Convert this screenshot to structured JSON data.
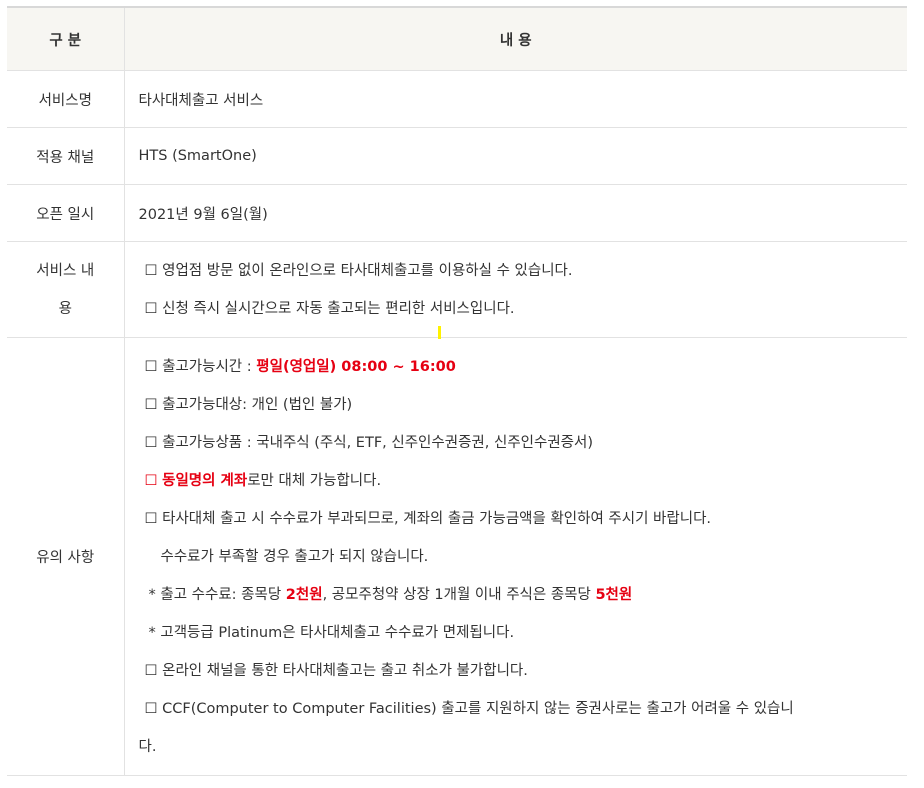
{
  "header": {
    "col1": "구 분",
    "col2": "내 용"
  },
  "rows": {
    "service_name": {
      "label": "서비스명",
      "value": "타사대체출고 서비스"
    },
    "channel": {
      "label": "적용 채널",
      "value": "HTS (SmartOne)"
    },
    "open_date": {
      "label": "오픈 일시",
      "value": "2021년 9월 6일(월)"
    },
    "service_content": {
      "label_line1": "서비스 내",
      "label_line2": "용",
      "lines": [
        "☐ 영업점 방문 없이 온라인으로 타사대체출고를 이용하실 수 있습니다.",
        "☐ 신청 즉시 실시간으로 자동 출고되는 편리한 서비스입니다."
      ]
    },
    "notes": {
      "label": "유의 사항",
      "time_prefix": "☐ 출고가능시간 : ",
      "time_value": "평일(영업일) 08:00 ~ 16:00",
      "target": "☐ 출고가능대상: 개인 (법인 불가)",
      "product_prefix": "☐ 출고가능상품 : ",
      "product_hl": "국내주식",
      "product_suffix": " (주식, ETF, 신주인수권증권, 신주인수권증서)",
      "same_prefix": "☐ ",
      "same_red": "동일명의 계좌",
      "same_suffix": "로만 대체 가능합니다.",
      "fee_prefix": "☐ 타사대체 출고 시 ",
      "fee_hl": "수수료",
      "fee_suffix": "가 부과되므로, 계좌의 출금 가능금액을 확인하여 주시기 바랍니다.",
      "fee_cont": "수수료가 부족할 경우 출고가 되지 않습니다.",
      "fee_detail_prefix": "* 출고 수수료: 종목당 ",
      "fee_detail_red1": "2천원",
      "fee_detail_mid": ", 공모주청약 상장 1개월 이내 주식은 종목당 ",
      "fee_detail_red2": "5천원",
      "platinum": "* 고객등급 Platinum은 타사대체출고 수수료가 면제됩니다.",
      "cancel": "☐ 온라인 채널을 통한 타사대체출고는 출고 취소가 불가합니다.",
      "ccf_line1": "☐ CCF(Computer to Computer Facilities) 출고를 지원하지 않는 증권사로는 출고가 어려울 수 있습니",
      "ccf_line2": "다."
    }
  },
  "colors": {
    "header_bg": "#f7f6f2",
    "red": "#e60012",
    "highlight": "#fff200"
  }
}
